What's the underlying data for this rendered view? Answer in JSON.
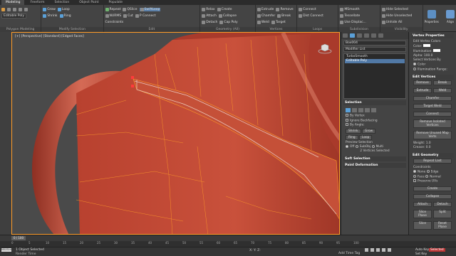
{
  "ribbon": {
    "tabs": [
      "Modeling",
      "Freeform",
      "Selection",
      "Object Paint",
      "Populate"
    ],
    "groups": {
      "polygon_modeling": {
        "title": "Polygon Modeling",
        "editable_poly": "Editable Poly"
      },
      "modify_selection": {
        "title": "Modify Selection",
        "grow": "Grow",
        "shrink": "Shrink",
        "loop": "Loop",
        "ring": "Ring"
      },
      "edit": {
        "title": "Edit",
        "repeat": "Repeat",
        "quickslice": "QSlice",
        "swiftloop": "SwiftLoop",
        "nurms": "NURMS",
        "cut": "Cut",
        "pconnect": "P Connect",
        "constraints": "Constraints"
      },
      "geometry": {
        "title": "Geometry (All)",
        "relax": "Relax",
        "create": "Create",
        "attach": "Attach",
        "collapse": "Collapse",
        "detach": "Detach",
        "cap_poly": "Cap Poly"
      },
      "vertices": {
        "title": "Vertices",
        "extrude": "Extrude",
        "remove": "Remove",
        "chamfer": "Chamfer",
        "break": "Break",
        "weld": "Weld",
        "target": "Target"
      },
      "loops": {
        "title": "Loops",
        "connect": "Connect",
        "dist_connect": "Dist Connect"
      },
      "subdivision": {
        "title": "Subdivision",
        "meshsmooth": "MSmooth",
        "tessellate": "Tessellate",
        "use_displace": "Use Displac..."
      },
      "visibility": {
        "title": "Visibility",
        "hide_selected": "Hide Selected",
        "hide_unselected": "Hide Unselected",
        "unhide_all": "Unhide All"
      },
      "properties": {
        "title": "Properties",
        "align": "Align"
      }
    }
  },
  "viewport": {
    "label": "[+] [Perspective] [Standard] [Edged Faces]",
    "accent_color": "#ff9d2a",
    "mesh_color": "#c24a3a"
  },
  "command_panel": {
    "object_name": "Box004",
    "modifier_list": "Modifier List",
    "stack": [
      "TurboSmooth",
      "Editable Poly"
    ],
    "selection": {
      "title": "Selection",
      "by_vertex": "By Vertex",
      "ignore_backfacing": "Ignore Backfacing",
      "by_angle": "By Angle:",
      "shrink": "Shrink",
      "grow": "Grow",
      "ring": "Ring",
      "loop": "Loop",
      "preview_selection": "Preview Selection",
      "off": "Off",
      "subobj": "SubObj",
      "multi": "Multi",
      "status": "2 Vertices Selected"
    },
    "soft_selection": "Soft Selection",
    "paint_deformation": "Paint Deformation"
  },
  "side_panel": {
    "vertex_properties": {
      "title": "Vertex Properties",
      "edit_vertex_colors": "Edit Vertex Colors",
      "color": "Color:",
      "illumination": "Illumination:",
      "alpha": "Alpha:",
      "alpha_value": "100.0",
      "select_vertices_by": "Select Vertices By",
      "color_opt": "Color",
      "illumination_opt": "Illumination",
      "range": "Range:"
    },
    "edit_vertices": {
      "title": "Edit Vertices",
      "remove": "Remove",
      "break": "Break",
      "extrude": "Extrude",
      "weld": "Weld",
      "chamfer": "Chamfer",
      "target_weld": "Target Weld",
      "connect": "Connect",
      "remove_isolated": "Remove Isolated Vertices",
      "remove_unused": "Remove Unused Map Verts",
      "weight_label": "Weight:",
      "weight_value": "1.0",
      "crease_label": "Crease:",
      "crease_value": "0.0"
    },
    "edit_geometry": {
      "title": "Edit Geometry",
      "repeat_last": "Repeat Last",
      "constraints": "Constraints",
      "none": "None",
      "edge": "Edge",
      "face": "Face",
      "normal": "Normal",
      "preserve_uvs": "Preserve UVs",
      "create": "Create",
      "collapse": "Collapse",
      "attach": "Attach",
      "detach": "Detach",
      "slice_plane": "Slice Plane",
      "split": "Split",
      "slice": "Slice",
      "reset_plane": "Reset Plane"
    }
  },
  "timeline": {
    "frame": "0 / 100",
    "ticks": [
      "0",
      "5",
      "10",
      "15",
      "20",
      "25",
      "30",
      "35",
      "40",
      "45",
      "50",
      "55",
      "60",
      "65",
      "70",
      "75",
      "80",
      "85",
      "90",
      "95",
      "100"
    ]
  },
  "status_bar": {
    "maxscript": "MAXScript",
    "line1": "1 Object Selected",
    "line2": "Render Time",
    "coords": "X:    Y:    Z:",
    "add_time_tag": "Add Time Tag",
    "auto_key": "Auto Key",
    "set_key": "Set Key",
    "selected": "Selected",
    "key_filters": "Key Filters..."
  }
}
